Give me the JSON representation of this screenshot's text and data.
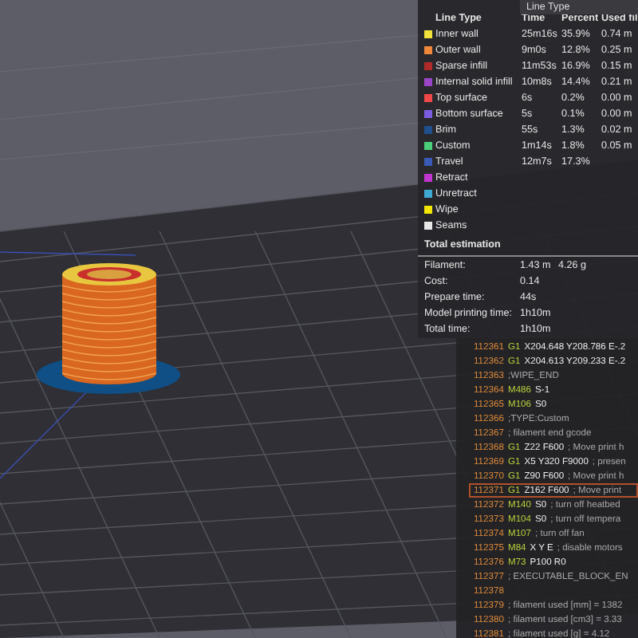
{
  "view_selector": {
    "value": "Line Type"
  },
  "legend": {
    "columns": [
      "Line Type",
      "Time",
      "Percent",
      "Used fil"
    ],
    "rows": [
      {
        "name": "Inner wall",
        "color": "#f2e23c",
        "time": "25m16s",
        "percent": "35.9%",
        "used": "0.74 m"
      },
      {
        "name": "Outer wall",
        "color": "#f0883a",
        "time": "9m0s",
        "percent": "12.8%",
        "used": "0.25 m"
      },
      {
        "name": "Sparse infill",
        "color": "#b02a2a",
        "time": "11m53s",
        "percent": "16.9%",
        "used": "0.15 m"
      },
      {
        "name": "Internal solid infill",
        "color": "#9a45c8",
        "time": "10m8s",
        "percent": "14.4%",
        "used": "0.21 m"
      },
      {
        "name": "Top surface",
        "color": "#f04848",
        "time": "6s",
        "percent": "0.2%",
        "used": "0.00 m"
      },
      {
        "name": "Bottom surface",
        "color": "#7a5ce0",
        "time": "5s",
        "percent": "0.1%",
        "used": "0.00 m"
      },
      {
        "name": "Brim",
        "color": "#1f4f8c",
        "time": "55s",
        "percent": "1.3%",
        "used": "0.02 m"
      },
      {
        "name": "Custom",
        "color": "#4ccf7a",
        "time": "1m14s",
        "percent": "1.8%",
        "used": "0.05 m"
      },
      {
        "name": "Travel",
        "color": "#3a5ab8",
        "time": "12m7s",
        "percent": "17.3%"
      },
      {
        "name": "Retract",
        "color": "#c236d0"
      },
      {
        "name": "Unretract",
        "color": "#3fa9d6"
      },
      {
        "name": "Wipe",
        "color": "#f3e600"
      },
      {
        "name": "Seams",
        "color": "#e8e8e8"
      }
    ]
  },
  "total_estimation": {
    "title": "Total estimation",
    "rows": [
      {
        "label": "Filament:",
        "value": "1.43 m",
        "extra": "4.26 g"
      },
      {
        "label": "Cost:",
        "value": "0.14"
      },
      {
        "label": "Prepare time:",
        "value": "44s"
      },
      {
        "label": "Model printing time:",
        "value": "1h10m"
      },
      {
        "label": "Total time:",
        "value": "1h10m"
      }
    ]
  },
  "gcode": [
    {
      "number": "112361",
      "command": "G1",
      "args": "X204.648 Y208.786 E-.2",
      "selected": false
    },
    {
      "number": "112362",
      "command": "G1",
      "args": "X204.613 Y209.233 E-.2",
      "selected": false
    },
    {
      "number": "112363",
      "comment": ";WIPE_END",
      "selected": false
    },
    {
      "number": "112364",
      "command": "M486",
      "args": "S-1",
      "selected": false
    },
    {
      "number": "112365",
      "command": "M106",
      "args": "S0",
      "selected": false
    },
    {
      "number": "112366",
      "comment": ";TYPE:Custom",
      "selected": false
    },
    {
      "number": "112367",
      "comment": "; filament end gcode",
      "selected": false
    },
    {
      "number": "112368",
      "command": "G1",
      "args": "Z22 F600",
      "comment": "; Move print h",
      "selected": false
    },
    {
      "number": "112369",
      "command": "G1",
      "args": "X5 Y320 F9000",
      "comment": "; presen",
      "selected": false
    },
    {
      "number": "112370",
      "command": "G1",
      "args": "Z90 F600",
      "comment": "; Move print h",
      "selected": false
    },
    {
      "number": "112371",
      "command": "G1",
      "args": "Z162 F600",
      "comment": "; Move print",
      "selected": true
    },
    {
      "number": "112372",
      "command": "M140",
      "args": "S0",
      "comment": "; turn off heatbed",
      "selected": false
    },
    {
      "number": "112373",
      "command": "M104",
      "args": "S0",
      "comment": "; turn off tempera",
      "selected": false
    },
    {
      "number": "112374",
      "command": "M107",
      "comment": "; turn off fan",
      "selected": false
    },
    {
      "number": "112375",
      "command": "M84",
      "args": "X Y E",
      "comment": "; disable motors",
      "selected": false
    },
    {
      "number": "112376",
      "command": "M73",
      "args": "P100 R0",
      "selected": false
    },
    {
      "number": "112377",
      "comment": "; EXECUTABLE_BLOCK_EN",
      "selected": false
    },
    {
      "number": "112378",
      "selected": false
    },
    {
      "number": "112379",
      "comment": "; filament used [mm] = 1382",
      "selected": false
    },
    {
      "number": "112380",
      "comment": "; filament used [cm3] = 3.33",
      "selected": false
    },
    {
      "number": "112381",
      "comment": "; filament used [g] = 4.12",
      "selected": false
    }
  ]
}
